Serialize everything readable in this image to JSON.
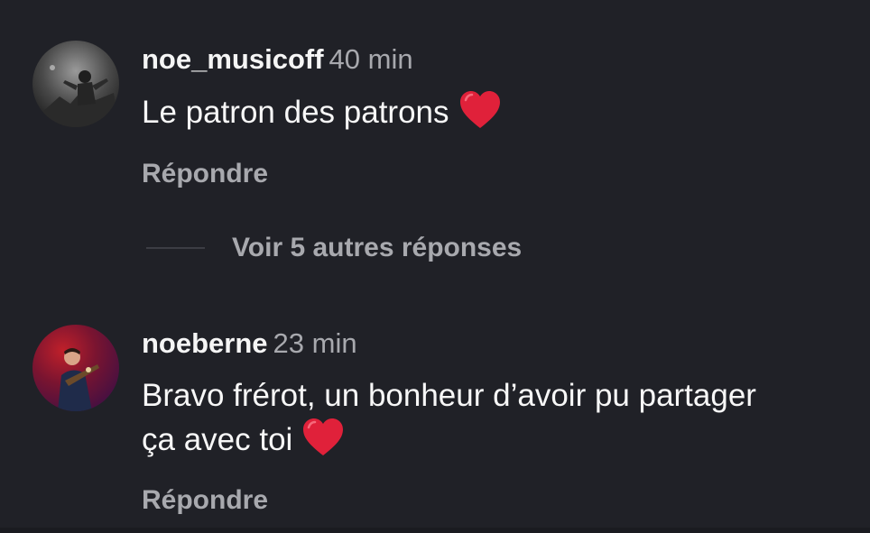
{
  "comments": [
    {
      "username": "noe_musicoff",
      "time": "40 min",
      "text": "Le patron des patrons",
      "reply_label": "Répondre"
    },
    {
      "username": "noeberne",
      "time": "23 min",
      "text": "Bravo frérot, un bonheur d’avoir pu partager ça avec toi",
      "reply_label": "Répondre"
    }
  ],
  "more_replies_label": "Voir 5 autres réponses",
  "colors": {
    "background": "#202127",
    "muted": "#a8a9ae",
    "heart": "#e0213a"
  },
  "icons": [
    "heart-icon",
    "avatar-noe-musicoff",
    "avatar-noeberne"
  ]
}
